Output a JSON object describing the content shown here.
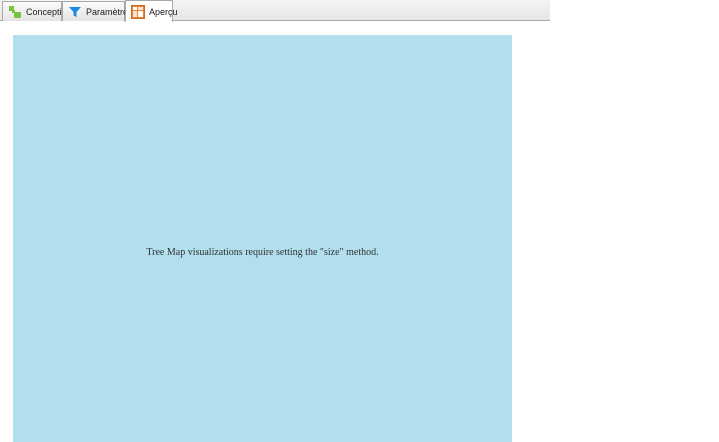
{
  "tabs": [
    {
      "label": "Conception",
      "icon": "design-icon",
      "active": false
    },
    {
      "label": "Paramètres",
      "icon": "filter-icon",
      "active": false
    },
    {
      "label": "Aperçu",
      "icon": "preview-icon",
      "active": true
    }
  ],
  "preview": {
    "message": "Tree Map visualizations require setting the \"size\" method.",
    "background_color": "#b1dfee"
  },
  "colors": {
    "design_icon": "#7cc242",
    "filter_icon": "#1e88e5",
    "preview_icon": "#e8833a"
  }
}
